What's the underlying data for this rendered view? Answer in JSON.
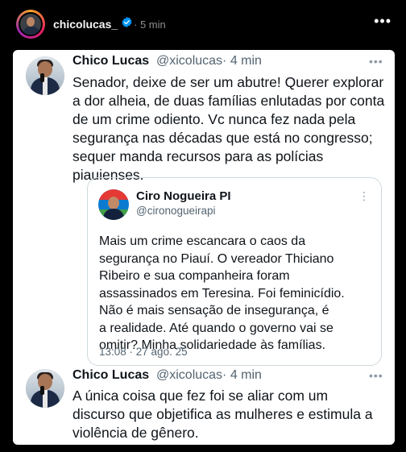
{
  "header": {
    "username": "chicolucas_",
    "time": "5 min",
    "more": "•••"
  },
  "tweet1": {
    "name": "Chico Lucas",
    "handle": "@xicolucas",
    "time": "· 4 min",
    "more": "•••",
    "lines": [
      "Senador, deixe de ser um abutre! Querer explorar",
      "a dor alheia, de duas famílias enlutadas por conta",
      "de um crime odiento. Vc nunca fez nada pela",
      "segurança nas décadas que está no congresso;",
      "sequer manda recursos para as polícias",
      "piauienses."
    ]
  },
  "quote": {
    "name": "Ciro Nogueira PI",
    "handle": "@cironogueirapi",
    "more": "⋮",
    "lines": [
      "Mais um crime escancara o caos da",
      "segurança no Piauí. O vereador Thiciano",
      "Ribeiro e sua companheira foram",
      "assassinados em Teresina. Foi feminicídio.",
      "Não é mais sensação de insegurança, é",
      "a realidade. Até quando o governo vai se",
      "omitir? Minha solidariedade às famílias."
    ],
    "date": "13:08 · 27 ago. 25"
  },
  "tweet2": {
    "name": "Chico Lucas",
    "handle": "@xicolucas",
    "time": "· 4 min",
    "more": "•••",
    "lines": [
      "A única coisa que fez foi se aliar com um",
      "discurso que objetifica as mulheres e estimula a",
      "violência de gênero."
    ]
  }
}
